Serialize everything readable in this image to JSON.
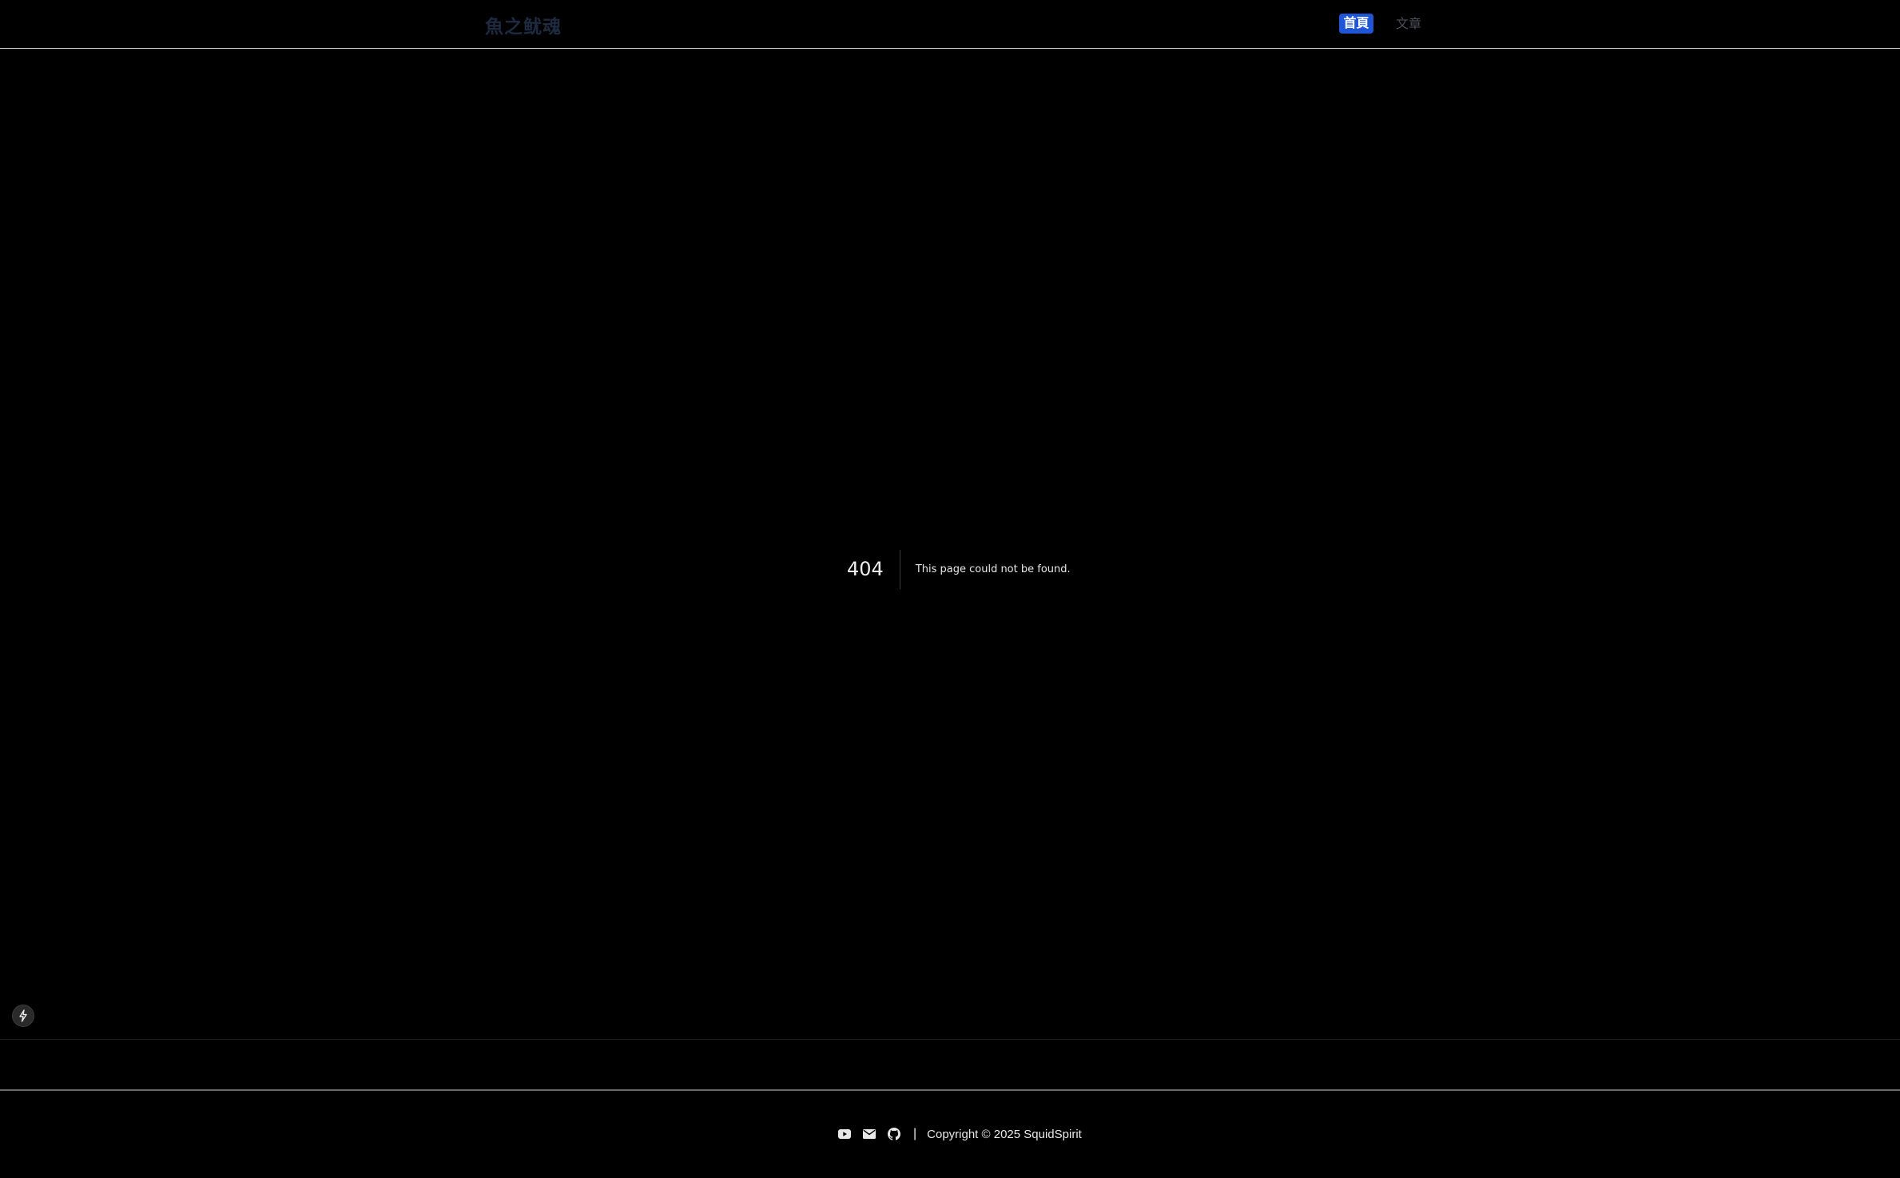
{
  "header": {
    "brand": "魚之鱿魂",
    "nav": {
      "home_label": "首頁",
      "articles_label": "文章"
    }
  },
  "not_found": {
    "code": "404",
    "message": "This page could not be found."
  },
  "footer": {
    "icons": [
      "youtube-icon",
      "mail-icon",
      "github-icon"
    ],
    "separator": "|",
    "copyright": "Copyright © 2025 SquidSpirit"
  },
  "colors": {
    "background": "#000000",
    "nav_active_bg": "#1f56d6",
    "brand_text": "#1e2a40"
  }
}
